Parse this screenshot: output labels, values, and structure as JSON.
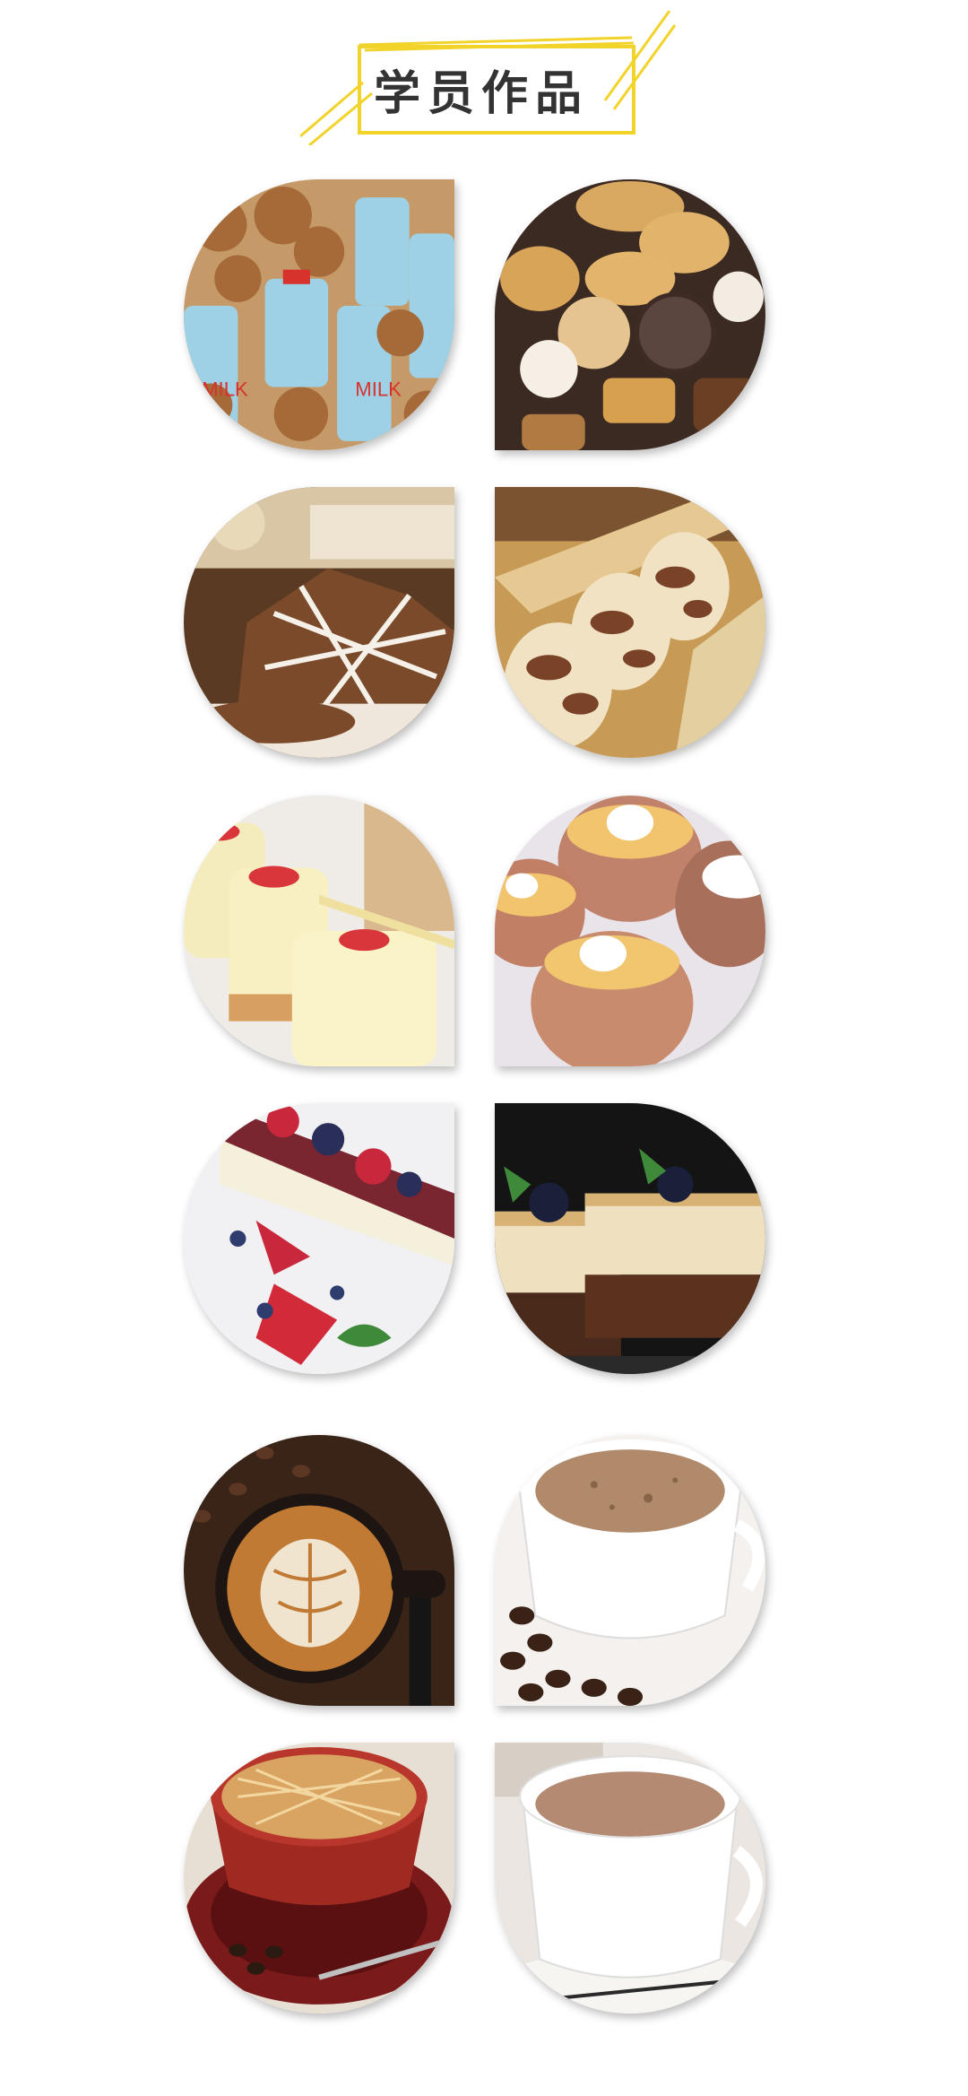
{
  "header": {
    "title": "学员作品"
  },
  "gallery": {
    "items": [
      {
        "name": "milk-cookies-image",
        "shape": "tr"
      },
      {
        "name": "assorted-cookies-image",
        "shape": "bl"
      },
      {
        "name": "snowflake-cookies-image",
        "shape": "tr"
      },
      {
        "name": "marble-cookies-image",
        "shape": "tl"
      },
      {
        "name": "mini-cakes-image",
        "shape": "br"
      },
      {
        "name": "egg-pudding-image",
        "shape": "bl"
      },
      {
        "name": "berry-cheesecake-image",
        "shape": "tr"
      },
      {
        "name": "mousse-cake-image",
        "shape": "tl"
      },
      {
        "name": "latte-art-image",
        "shape": "br"
      },
      {
        "name": "coffee-cup-image",
        "shape": "bl"
      },
      {
        "name": "caramel-coffee-image",
        "shape": "tr"
      },
      {
        "name": "milk-tea-image",
        "shape": "tl"
      }
    ]
  },
  "colors": {
    "accent_yellow": "#f2d32a",
    "title_text": "#333333"
  }
}
